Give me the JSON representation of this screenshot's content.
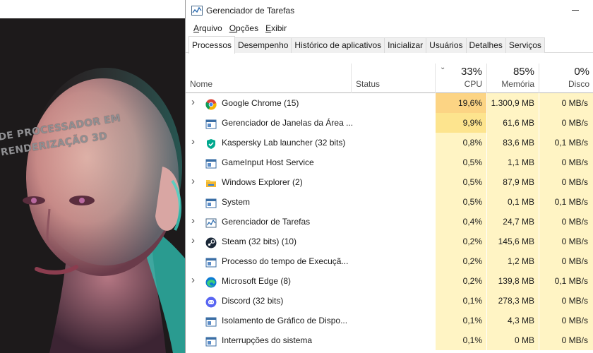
{
  "window": {
    "title": "Gerenciador de Tarefas"
  },
  "wallpaper": {
    "line1": "DE PROCESSADOR EM",
    "line2": "RENDERIZAÇÃO 3D"
  },
  "menu": [
    {
      "underline": "A",
      "rest": "rquivo"
    },
    {
      "underline": "O",
      "rest": "pções"
    },
    {
      "underline": "E",
      "rest": "xibir"
    }
  ],
  "tabs": [
    "Processos",
    "Desempenho",
    "Histórico de aplicativos",
    "Inicializar",
    "Usuários",
    "Detalhes",
    "Serviços"
  ],
  "active_tab": "Processos",
  "columns": {
    "name": "Nome",
    "status": "Status",
    "cpu": {
      "percent": "33%",
      "label": "CPU"
    },
    "memory": {
      "percent": "85%",
      "label": "Memória"
    },
    "disk": {
      "percent": "0%",
      "label": "Disco"
    }
  },
  "colors": {
    "cpu_heat_high": "#fcd484",
    "cpu_heat_mid": "#fde48e",
    "cell_heat": "#fff4c4",
    "disk_heat": "#fff4c4"
  },
  "processes": [
    {
      "name": "Google Chrome (15)",
      "expandable": true,
      "icon": "chrome-icon",
      "status": "",
      "cpu": "19,6%",
      "memory": "1.300,9 MB",
      "disk": "0 MB/s"
    },
    {
      "name": "Gerenciador de Janelas da Área ...",
      "expandable": false,
      "icon": "window-app-icon",
      "status": "",
      "cpu": "9,9%",
      "memory": "61,6 MB",
      "disk": "0 MB/s"
    },
    {
      "name": "Kaspersky Lab launcher (32 bits)",
      "expandable": true,
      "icon": "kaspersky-shield-icon",
      "status": "",
      "cpu": "0,8%",
      "memory": "83,6 MB",
      "disk": "0,1 MB/s"
    },
    {
      "name": "GameInput Host Service",
      "expandable": false,
      "icon": "window-app-icon",
      "status": "",
      "cpu": "0,5%",
      "memory": "1,1 MB",
      "disk": "0 MB/s"
    },
    {
      "name": "Windows Explorer (2)",
      "expandable": true,
      "icon": "folder-icon",
      "status": "",
      "cpu": "0,5%",
      "memory": "87,9 MB",
      "disk": "0 MB/s"
    },
    {
      "name": "System",
      "expandable": false,
      "icon": "window-app-icon",
      "status": "",
      "cpu": "0,5%",
      "memory": "0,1 MB",
      "disk": "0,1 MB/s"
    },
    {
      "name": "Gerenciador de Tarefas",
      "expandable": true,
      "icon": "task-manager-icon",
      "status": "",
      "cpu": "0,4%",
      "memory": "24,7 MB",
      "disk": "0 MB/s"
    },
    {
      "name": "Steam (32 bits) (10)",
      "expandable": true,
      "icon": "steam-icon",
      "status": "",
      "cpu": "0,2%",
      "memory": "145,6 MB",
      "disk": "0 MB/s"
    },
    {
      "name": "Processo do tempo de Execuçã...",
      "expandable": false,
      "icon": "window-app-icon",
      "status": "",
      "cpu": "0,2%",
      "memory": "1,2 MB",
      "disk": "0 MB/s"
    },
    {
      "name": "Microsoft Edge (8)",
      "expandable": true,
      "icon": "edge-icon",
      "status": "",
      "cpu": "0,2%",
      "memory": "139,8 MB",
      "disk": "0,1 MB/s"
    },
    {
      "name": "Discord (32 bits)",
      "expandable": false,
      "icon": "discord-icon",
      "status": "",
      "cpu": "0,1%",
      "memory": "278,3 MB",
      "disk": "0 MB/s"
    },
    {
      "name": "Isolamento de Gráfico de Dispo...",
      "expandable": false,
      "icon": "window-app-icon",
      "status": "",
      "cpu": "0,1%",
      "memory": "4,3 MB",
      "disk": "0 MB/s"
    },
    {
      "name": "Interrupções do sistema",
      "expandable": false,
      "icon": "window-app-icon",
      "status": "",
      "cpu": "0,1%",
      "memory": "0 MB",
      "disk": "0 MB/s"
    }
  ]
}
